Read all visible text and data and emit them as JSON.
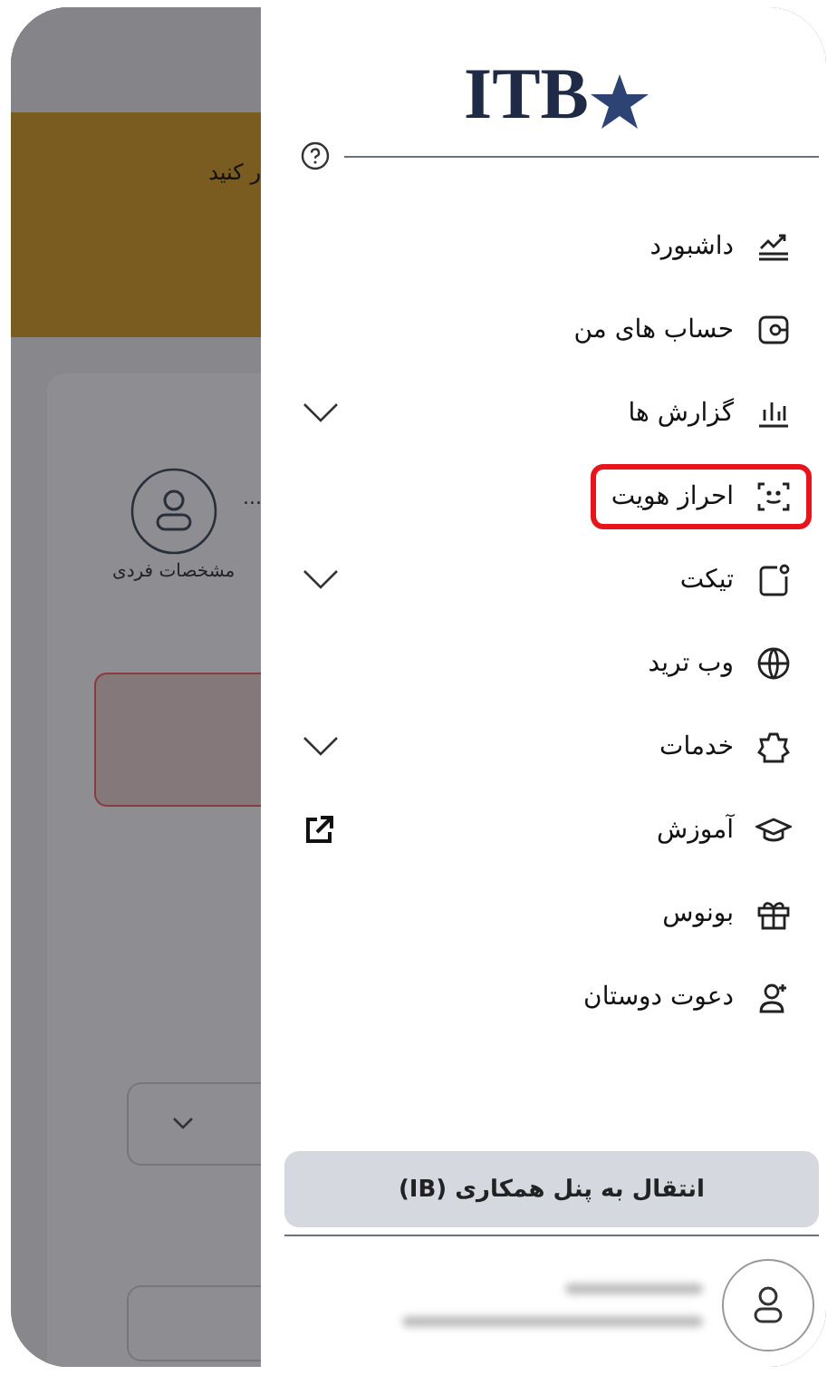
{
  "background": {
    "banner_text": "ر کنید",
    "step_more": "...",
    "step_label": "مشخصات فردی"
  },
  "drawer": {
    "logo": "ITB",
    "menu": [
      {
        "label": "داشبورد",
        "kind": "plain",
        "highlighted": false
      },
      {
        "label": "حساب های من",
        "kind": "plain",
        "highlighted": false
      },
      {
        "label": "گزارش ها",
        "kind": "expand",
        "highlighted": false
      },
      {
        "label": "احراز هویت",
        "kind": "plain",
        "highlighted": true
      },
      {
        "label": "تیکت",
        "kind": "expand",
        "highlighted": false
      },
      {
        "label": "وب ترید",
        "kind": "plain",
        "highlighted": false
      },
      {
        "label": "خدمات",
        "kind": "expand",
        "highlighted": false
      },
      {
        "label": "آموزش",
        "kind": "external",
        "highlighted": false
      },
      {
        "label": "بونوس",
        "kind": "plain",
        "highlighted": false
      },
      {
        "label": "دعوت دوستان",
        "kind": "plain",
        "highlighted": false
      }
    ],
    "panel_button": "انتقال به پنل همکاری (IB)"
  }
}
